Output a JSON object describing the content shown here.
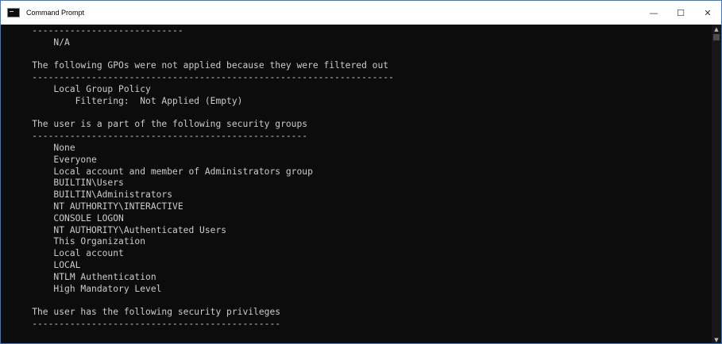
{
  "window": {
    "title": "Command Prompt",
    "controls": {
      "minimize": "—",
      "maximize": "☐",
      "close": "✕"
    },
    "scroll_up": "▲",
    "scroll_down": "▼"
  },
  "console": {
    "lines": [
      "    ----------------------------",
      "        N/A",
      "",
      "    The following GPOs were not applied because they were filtered out",
      "    -------------------------------------------------------------------",
      "        Local Group Policy",
      "            Filtering:  Not Applied (Empty)",
      "",
      "    The user is a part of the following security groups",
      "    ---------------------------------------------------",
      "        None",
      "        Everyone",
      "        Local account and member of Administrators group",
      "        BUILTIN\\Users",
      "        BUILTIN\\Administrators",
      "        NT AUTHORITY\\INTERACTIVE",
      "        CONSOLE LOGON",
      "        NT AUTHORITY\\Authenticated Users",
      "        This Organization",
      "        Local account",
      "        LOCAL",
      "        NTLM Authentication",
      "        High Mandatory Level",
      "",
      "    The user has the following security privileges",
      "    ----------------------------------------------"
    ]
  },
  "colors": {
    "console_bg": "#0c0c0c",
    "console_text": "#cccccc",
    "titlebar_bg": "#ffffff",
    "border": "#3a78c9"
  }
}
